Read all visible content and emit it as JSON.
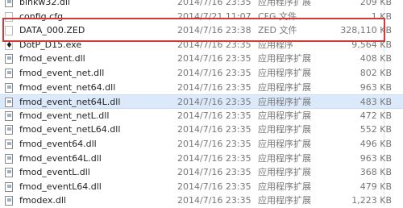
{
  "files": [
    {
      "name": "binkw32.dll",
      "date": "2014/7/16 23:35",
      "type": "应用程序扩展",
      "size": "209 KB",
      "icon": "dll-icon"
    },
    {
      "name": "config.cfg",
      "date": "2014/7/21 11:07",
      "type": "CFG 文件",
      "size": "1 KB",
      "icon": "doc-icon"
    },
    {
      "name": "DATA_000.ZED",
      "date": "2014/7/16 23:38",
      "type": "ZED 文件",
      "size": "328,110 KB",
      "icon": "doc-icon"
    },
    {
      "name": "DotP_D15.exe",
      "date": "2014/7/16 23:35",
      "type": "应用程序",
      "size": "9,564 KB",
      "icon": "exe-icon"
    },
    {
      "name": "fmod_event.dll",
      "date": "2014/7/16 23:35",
      "type": "应用程序扩展",
      "size": "408 KB",
      "icon": "dll-icon"
    },
    {
      "name": "fmod_event_net.dll",
      "date": "2014/7/16 23:35",
      "type": "应用程序扩展",
      "size": "802 KB",
      "icon": "dll-icon"
    },
    {
      "name": "fmod_event_net64.dll",
      "date": "2014/7/16 23:35",
      "type": "应用程序扩展",
      "size": "963 KB",
      "icon": "dll-icon"
    },
    {
      "name": "fmod_event_net64L.dll",
      "date": "2014/7/16 23:35",
      "type": "应用程序扩展",
      "size": "483 KB",
      "icon": "dll-icon"
    },
    {
      "name": "fmod_event_netL.dll",
      "date": "2014/7/16 23:35",
      "type": "应用程序扩展",
      "size": "472 KB",
      "icon": "dll-icon"
    },
    {
      "name": "fmod_event_netL64.dll",
      "date": "2014/7/16 23:35",
      "type": "应用程序扩展",
      "size": "552 KB",
      "icon": "dll-icon"
    },
    {
      "name": "fmod_event64.dll",
      "date": "2014/7/16 23:35",
      "type": "应用程序扩展",
      "size": "496 KB",
      "icon": "dll-icon"
    },
    {
      "name": "fmod_event64L.dll",
      "date": "2014/7/16 23:35",
      "type": "应用程序扩展",
      "size": "963 KB",
      "icon": "dll-icon"
    },
    {
      "name": "fmod_eventL.dll",
      "date": "2014/7/16 23:35",
      "type": "应用程序扩展",
      "size": "368 KB",
      "icon": "dll-icon"
    },
    {
      "name": "fmod_eventL64.dll",
      "date": "2014/7/16 23:35",
      "type": "应用程序扩展",
      "size": "479 KB",
      "icon": "dll-icon"
    },
    {
      "name": "fmodex.dll",
      "date": "2014/7/16 23:35",
      "type": "应用程序扩展",
      "size": "1,223 KB",
      "icon": "dll-icon"
    }
  ],
  "selected_file": "fmod_event_net64L.dll",
  "highlight_color": "#d13a3a"
}
